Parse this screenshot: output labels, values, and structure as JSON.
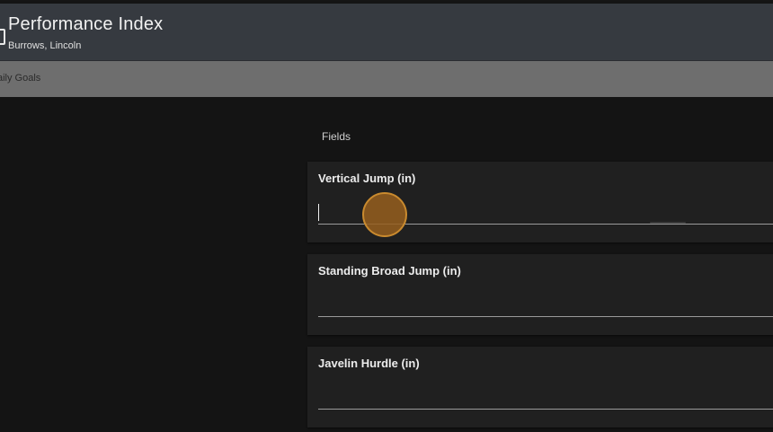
{
  "header": {
    "title": "Performance Index",
    "subtitle": "Burrows, Lincoln"
  },
  "tabs": [
    {
      "label": "aily Goals"
    }
  ],
  "section": {
    "heading": "Fields"
  },
  "fields": [
    {
      "label": "Vertical Jump (in)",
      "value": "",
      "placeholder": "",
      "focused": true
    },
    {
      "label": "Standing Broad Jump (in)",
      "value": "",
      "placeholder": ""
    },
    {
      "label": "Javelin Hurdle (in)",
      "value": "",
      "placeholder": ""
    }
  ],
  "colors": {
    "header_bg": "#363a40",
    "tabbar_bg": "#6e6e6e",
    "page_bg": "#141414",
    "card_bg": "#202020",
    "touch_indicator": "#c98a2e"
  },
  "icons": {
    "back": "back-arrow-icon"
  }
}
